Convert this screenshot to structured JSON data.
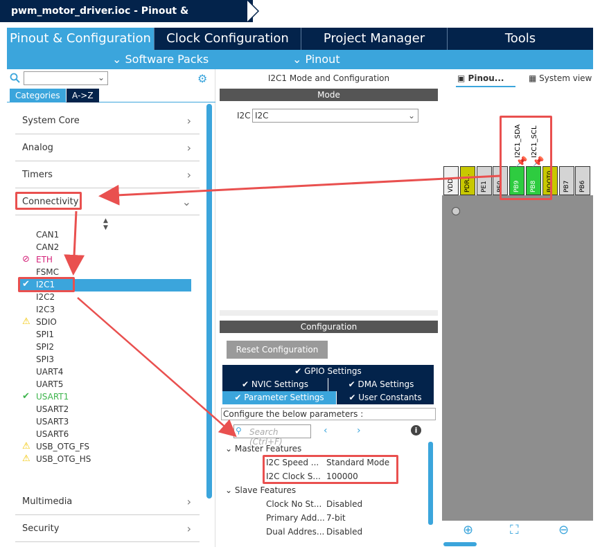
{
  "title": "pwm_motor_driver.ioc - Pinout & Configuration",
  "main_tabs": [
    "Pinout & Configuration",
    "Clock Configuration",
    "Project Manager",
    "Tools"
  ],
  "sub_menu": {
    "software_packs": "Software Packs",
    "pinout": "Pinout"
  },
  "left": {
    "cat_tabs": [
      "Categories",
      "A->Z"
    ],
    "categories_top": [
      "System Core",
      "Analog",
      "Timers",
      "Connectivity"
    ],
    "peripherals": [
      {
        "label": "CAN1",
        "status": ""
      },
      {
        "label": "CAN2",
        "status": ""
      },
      {
        "label": "ETH",
        "status": "disabled"
      },
      {
        "label": "FSMC",
        "status": ""
      },
      {
        "label": "I2C1",
        "status": "ok"
      },
      {
        "label": "I2C2",
        "status": ""
      },
      {
        "label": "I2C3",
        "status": ""
      },
      {
        "label": "SDIO",
        "status": "warn"
      },
      {
        "label": "SPI1",
        "status": ""
      },
      {
        "label": "SPI2",
        "status": ""
      },
      {
        "label": "SPI3",
        "status": ""
      },
      {
        "label": "UART4",
        "status": ""
      },
      {
        "label": "UART5",
        "status": ""
      },
      {
        "label": "USART1",
        "status": "ok"
      },
      {
        "label": "USART2",
        "status": ""
      },
      {
        "label": "USART3",
        "status": ""
      },
      {
        "label": "USART6",
        "status": ""
      },
      {
        "label": "USB_OTG_FS",
        "status": "warn"
      },
      {
        "label": "USB_OTG_HS",
        "status": "warn"
      }
    ],
    "categories_bottom": [
      "Multimedia",
      "Security"
    ]
  },
  "mid": {
    "panel_title": "I2C1 Mode and Configuration",
    "mode_header": "Mode",
    "mode_label": "I2C",
    "mode_value": "I2C",
    "config_header": "Configuration",
    "reset_btn": "Reset Configuration",
    "tabs": {
      "gpio": "GPIO Settings",
      "nvic": "NVIC Settings",
      "dma": "DMA Settings",
      "param": "Parameter Settings",
      "user": "User Constants"
    },
    "config_label": "Configure the below parameters :",
    "search_placeholder": "Search (Ctrl+F)",
    "master_group": "Master Features",
    "master_params": [
      {
        "name": "I2C Speed ...",
        "value": "Standard Mode"
      },
      {
        "name": "I2C Clock S...",
        "value": "100000"
      }
    ],
    "slave_group": "Slave Features",
    "slave_params": [
      {
        "name": "Clock No St...",
        "value": "Disabled"
      },
      {
        "name": "Primary Add...",
        "value": "7-bit"
      },
      {
        "name": "Dual Addres...",
        "value": "Disabled"
      }
    ]
  },
  "right": {
    "tab_pinout": "Pinou...",
    "tab_system": "System view",
    "pin_labels": [
      "I2C1_SDA",
      "I2C1_SCL"
    ],
    "pins": [
      "VDD",
      "PDR...",
      "PE1",
      "PE0",
      "PB9",
      "PB8",
      "BOOT0",
      "PB7",
      "PB6"
    ]
  },
  "colors": {
    "navy": "#03234b",
    "accent": "#3ba5dc",
    "ok": "#3cb44b",
    "warn": "#f2c500",
    "red": "#e9504f",
    "pin_green": "#2ecc40"
  }
}
